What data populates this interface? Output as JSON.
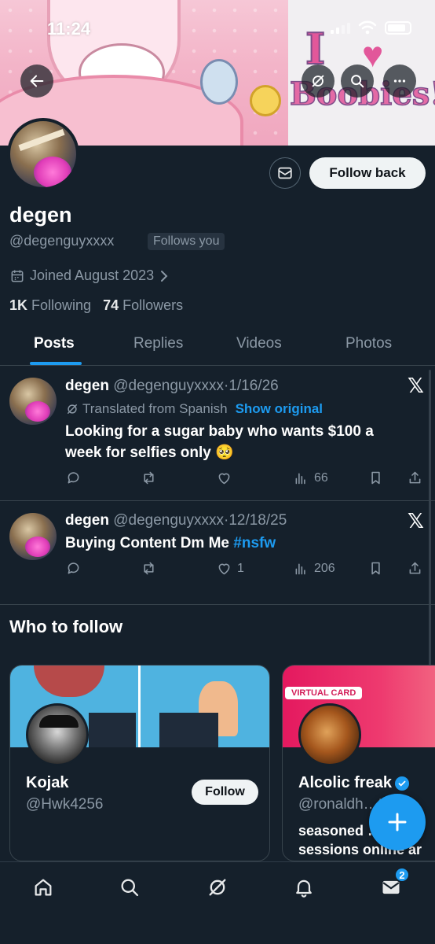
{
  "status_bar": {
    "time": "11:24"
  },
  "banner": {
    "text_love": "I",
    "text_boobies": "Boobies!"
  },
  "profile": {
    "display_name": "degen",
    "handle": "@degenguyxxxx",
    "follows_you": "Follows you",
    "follow_back_label": "Follow back",
    "joined": "Joined August 2023",
    "following_count": "1K",
    "following_label": "Following",
    "followers_count": "74",
    "followers_label": "Followers"
  },
  "tabs": [
    {
      "label": "Posts",
      "active": true
    },
    {
      "label": "Replies",
      "active": false
    },
    {
      "label": "Videos",
      "active": false
    },
    {
      "label": "Photos",
      "active": false
    }
  ],
  "posts": [
    {
      "name": "degen",
      "handle": "@degenguyxxxx",
      "date": "1/16/26",
      "translated_label": "Translated from Spanish",
      "show_original": "Show original",
      "text": "Looking for a sugar baby who wants $100 a week for selfies only 🥺",
      "likes": "",
      "views": "66"
    },
    {
      "name": "degen",
      "handle": "@degenguyxxxx",
      "date": "12/18/25",
      "text": "Buying Content Dm Me ",
      "hashtag": "#nsfw",
      "likes": "1",
      "views": "206"
    }
  ],
  "who_to_follow": {
    "title": "Who to follow",
    "cards": [
      {
        "name": "Kojak",
        "handle": "@Hwk4256",
        "follow_label": "Follow"
      },
      {
        "name": "Alcolic freak",
        "handle": "@ronaldh…ts",
        "badge": "VIRTUAL CARD",
        "bio": "seasoned … ik sessions online ar"
      }
    ]
  },
  "bottom_nav": {
    "messages_badge": "2"
  },
  "colors": {
    "background": "#15202b",
    "accent": "#1d9bf0",
    "muted": "#8b98a5"
  }
}
